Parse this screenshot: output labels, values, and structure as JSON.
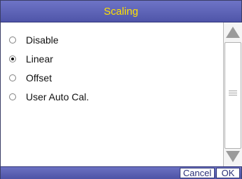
{
  "window": {
    "title": "Scaling"
  },
  "options": [
    {
      "label": "Disable",
      "selected": false
    },
    {
      "label": "Linear",
      "selected": true
    },
    {
      "label": "Offset",
      "selected": false
    },
    {
      "label": "User Auto Cal.",
      "selected": false
    }
  ],
  "buttons": {
    "cancel": "Cancel",
    "ok": "OK"
  },
  "colors": {
    "title_text": "#ffe000",
    "bar": "#5a60b4"
  },
  "icons": {
    "scroll_up": "triangle-up-icon",
    "scroll_down": "triangle-down-icon",
    "grip": "scrollbar-grip-icon"
  }
}
